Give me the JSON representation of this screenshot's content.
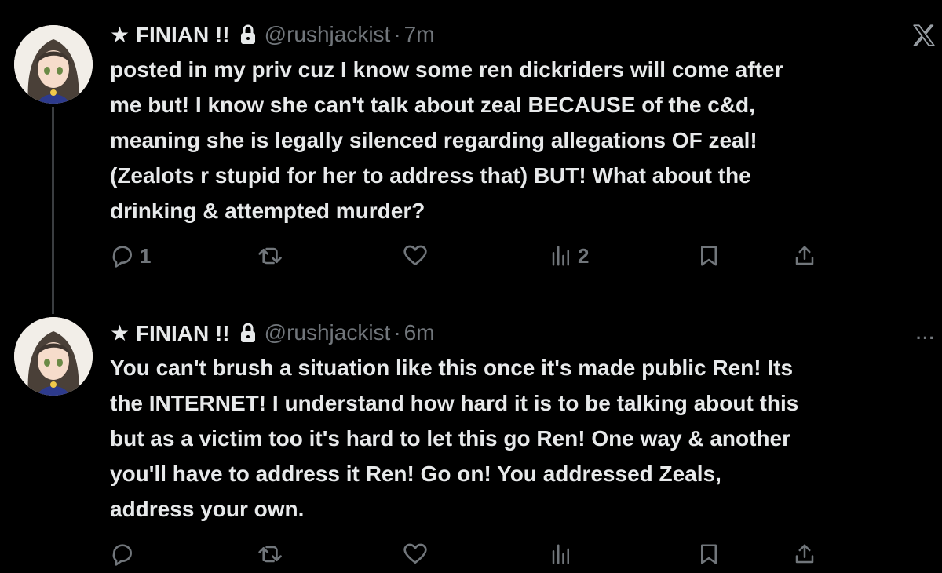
{
  "app": {
    "logo_label": "X"
  },
  "tweets": [
    {
      "author_name": "★ FINIAN !!",
      "handle": "@rushjackist",
      "separator": "·",
      "time": "7m",
      "text": "posted in my priv cuz I know some ren dickriders will come after\nme but! I know she can't talk about zeal BECAUSE of the c&d,\nmeaning she is legally silenced regarding allegations OF zeal!\n(Zealots r stupid for her to address that) BUT! What about the\ndrinking & attempted murder?",
      "reply_count": "1",
      "repost_count": "",
      "like_count": "",
      "view_count": "2"
    },
    {
      "author_name": "★ FINIAN !!",
      "handle": "@rushjackist",
      "separator": "·",
      "time": "6m",
      "text": "You can't brush a situation like this once it's made public Ren! Its\nthe INTERNET! I understand how hard it is to be talking about this\nbut as a victim too it's hard to let this go Ren! One way & another\nyou'll have to address it Ren! Go on! You addressed Zeals,\naddress your own.",
      "reply_count": "",
      "repost_count": "",
      "like_count": "",
      "view_count": ""
    }
  ],
  "more_label": "···",
  "icons": {
    "reply": "reply-icon",
    "repost": "repost-icon",
    "like": "heart-icon",
    "views": "views-icon",
    "bookmark": "bookmark-icon",
    "share": "share-icon",
    "lock": "lock-icon"
  },
  "colors": {
    "background": "#000000",
    "text": "#e7e9ea",
    "muted": "#71767b",
    "thread_line": "#3a3d40"
  }
}
